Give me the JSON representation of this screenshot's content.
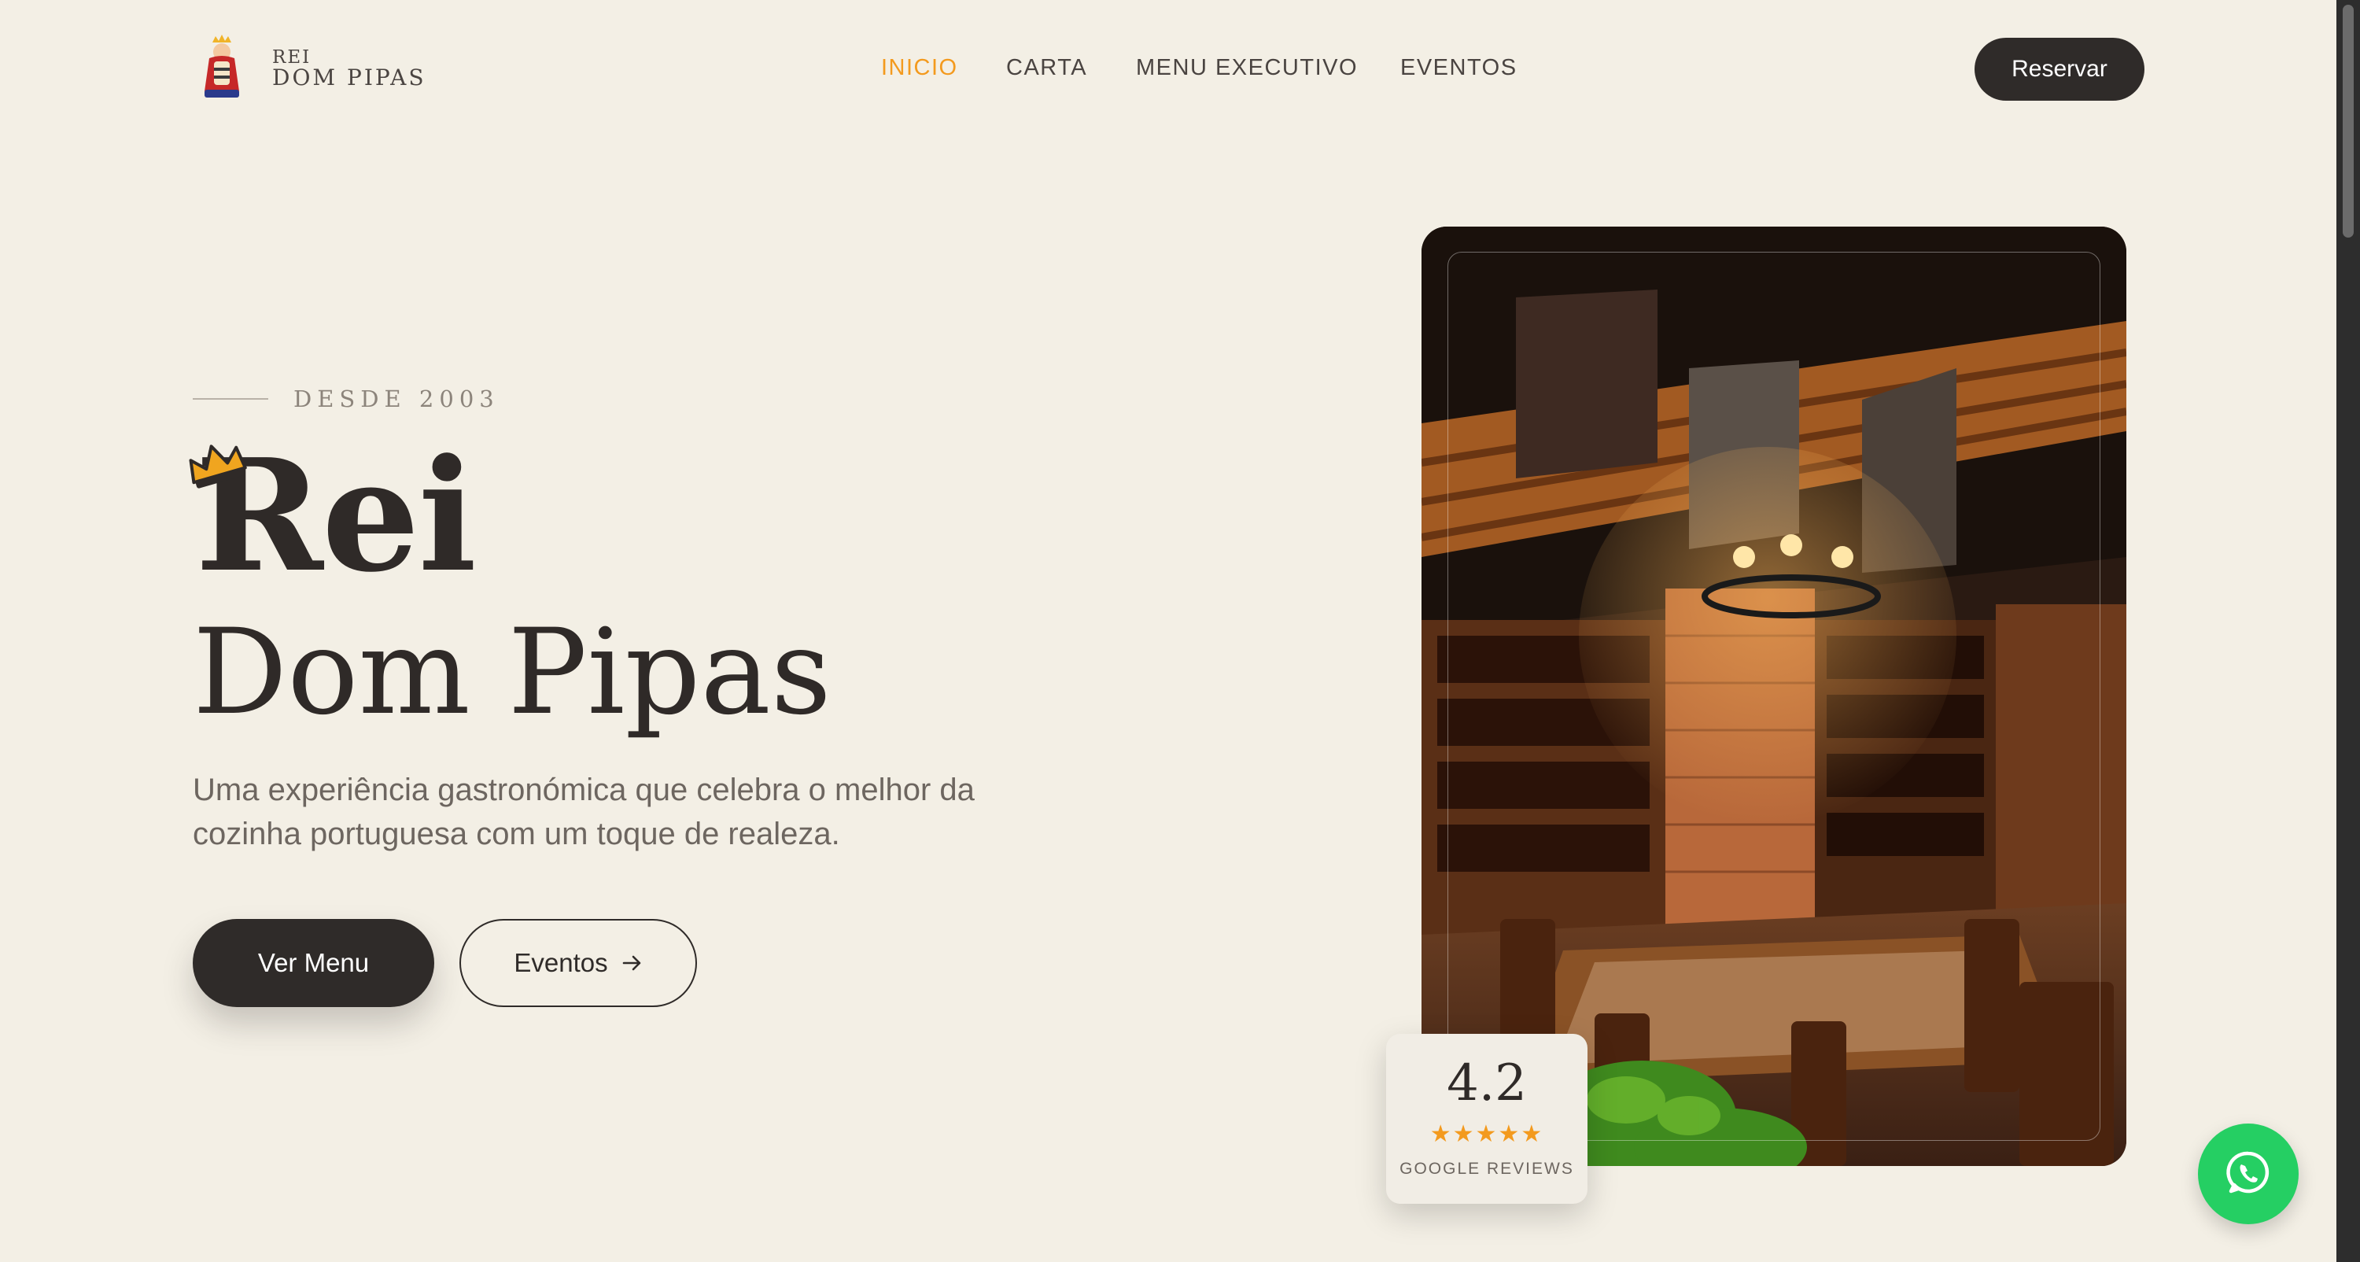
{
  "brand": {
    "line1": "REI",
    "line2": "DOM PIPAS"
  },
  "nav": {
    "items": [
      {
        "label": "INICIO",
        "active": true
      },
      {
        "label": "CARTA",
        "active": false
      },
      {
        "label": "MENU EXECUTIVO",
        "active": false
      },
      {
        "label": "EVENTOS",
        "active": false
      }
    ],
    "reserve_label": "Reservar"
  },
  "hero": {
    "eyebrow": "DESDE 2003",
    "title_line1": "Rei",
    "title_line2": "Dom Pipas",
    "lead": "Uma experiência gastronómica que celebra o melhor da cozinha portuguesa com um toque de realeza.",
    "primary_cta": "Ver Menu",
    "secondary_cta": "Eventos",
    "secondary_icon": "arrow-right-icon"
  },
  "rating": {
    "score": "4.2",
    "stars": "★★★★★",
    "source": "GOOGLE REVIEWS"
  },
  "floating": {
    "icon": "whatsapp-icon"
  },
  "colors": {
    "background": "#f3efe5",
    "text": "#2f2a28",
    "accent": "#f39a1e",
    "dark_button": "#2f2b29",
    "whatsapp": "#25cf63"
  }
}
